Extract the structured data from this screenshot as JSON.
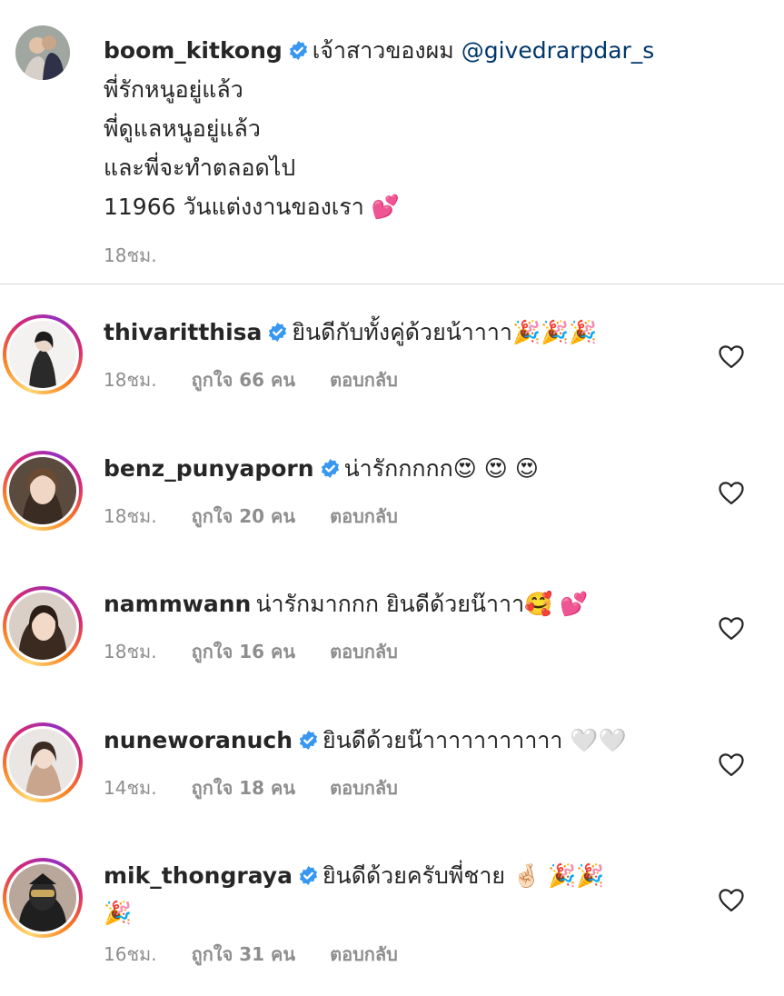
{
  "caption": {
    "username": "boom_kitkong",
    "text_head": "เจ้าสาวของผม",
    "mention": "@givedrarpdar_s",
    "lines": [
      "พี่รักหนูอยู่แล้ว",
      "พี่ดูแลหนูอยู่แล้ว",
      "และพี่จะทำตลอดไป",
      "11966 วันแต่งงานของเรา 💕"
    ],
    "time": "18ชม."
  },
  "comments": [
    {
      "username": "thivaritthisa",
      "verified": true,
      "text": "ยินดีกับทั้งคู่ด้วยน้าาาา🎉🎉🎉",
      "time": "18ชม.",
      "likes": "ถูกใจ 66 คน",
      "reply": "ตอบกลับ"
    },
    {
      "username": "benz_punyaporn",
      "verified": true,
      "text": "น่ารักกกกก😍 😍 😍",
      "time": "18ชม.",
      "likes": "ถูกใจ 20 คน",
      "reply": "ตอบกลับ"
    },
    {
      "username": "nammwann",
      "verified": false,
      "text": "น่ารักมากกก ยินดีด้วยน๊าาา🥰 💕",
      "time": "18ชม.",
      "likes": "ถูกใจ 16 คน",
      "reply": "ตอบกลับ"
    },
    {
      "username": "nuneworanuch",
      "verified": true,
      "text": "ยินดีด้วยน๊าาาาาาาาาาา 🤍🤍",
      "time": "14ชม.",
      "likes": "ถูกใจ 18 คน",
      "reply": "ตอบกลับ"
    },
    {
      "username": "mik_thongraya",
      "verified": true,
      "text": "ยินดีด้วยครับพี่ชาย 🤞🏻 🎉🎉",
      "text_line2": "🎉",
      "time": "16ชม.",
      "likes": "ถูกใจ 31 คน",
      "reply": "ตอบกลับ"
    }
  ],
  "icons": {
    "verified": "verified-badge-icon",
    "like": "heart-outline-icon"
  },
  "colors": {
    "verified": "#3897f0",
    "mention": "#00376b",
    "meta": "#8e8e8e"
  }
}
